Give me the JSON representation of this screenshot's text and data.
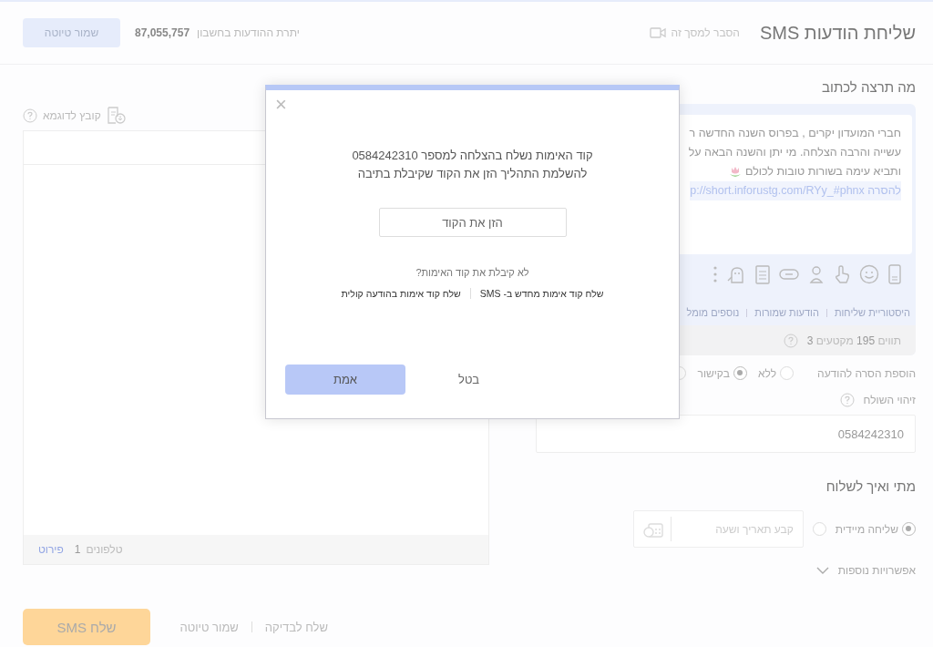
{
  "header": {
    "title": "שליחת הודעות SMS",
    "help_link": "הסבר למסך זה",
    "balance_label": "יתרת ההודעות בחשבון",
    "balance_value": "87,055,757",
    "save_draft_button": "שמור טיוטה"
  },
  "compose": {
    "title": "מה תרצה לכתוב",
    "message_lines": [
      "חברי המועדון יקרים , בפרוס השנה החדשה ר",
      "עשייה והרבה הצלחה. מי יתן והשנה הבאה על",
      "ותביא עימה בשורות טובות לכולם"
    ],
    "unsubscribe_link": "להסרה p://short.inforustg.com/RYy_#phnx",
    "tabs": [
      {
        "label": "היסטוריית שליחות",
        "selected": false
      },
      {
        "label": "הודעות שמורות",
        "selected": false
      },
      {
        "label": "נוספים מומל",
        "selected": false
      }
    ],
    "counter": "תווים **195** מקטעים **3**",
    "unsubscribe": {
      "label": "הוספת הסרה להודעה",
      "options": [
        {
          "label": "ללא",
          "selected": false
        },
        {
          "label": "בקישור",
          "selected": true
        },
        {
          "selected": false
        }
      ]
    },
    "sender": {
      "label": "זיהוי השולח",
      "value": "0584242310"
    }
  },
  "schedule": {
    "title": "מתי ואיך לשלוח",
    "options": [
      {
        "label": "שליחה מיידית",
        "selected": true
      },
      {
        "selected": false
      }
    ],
    "date_placeholder": "קבע תאריך ושעה",
    "more_options": "אפשרויות נוספות"
  },
  "recipients": {
    "sample_file": "קובץ לדוגמא",
    "phones_label": "טלפונים",
    "phones_count": "1",
    "details_link": "פירוט"
  },
  "footer": {
    "send_button": "שלח SMS",
    "links": [
      "שלח לבדיקה",
      "שמור טיוטה"
    ]
  },
  "dialog": {
    "message_lines": [
      "קוד האימות נשלח בהצלחה למספר 0584242310",
      "להשלמת התהליך הזן את הקוד שקיבלת בתיבה"
    ],
    "code_placeholder": "הזן את הקוד",
    "not_received": "לא קיבלת את קוד האימות?",
    "resend_links": [
      "שלח קוד אימות מחדש ב- SMS",
      "שלח קוד אימות בהודעה קולית"
    ],
    "confirm_button": "אמת",
    "cancel_button": "בטל",
    "close": "×"
  }
}
